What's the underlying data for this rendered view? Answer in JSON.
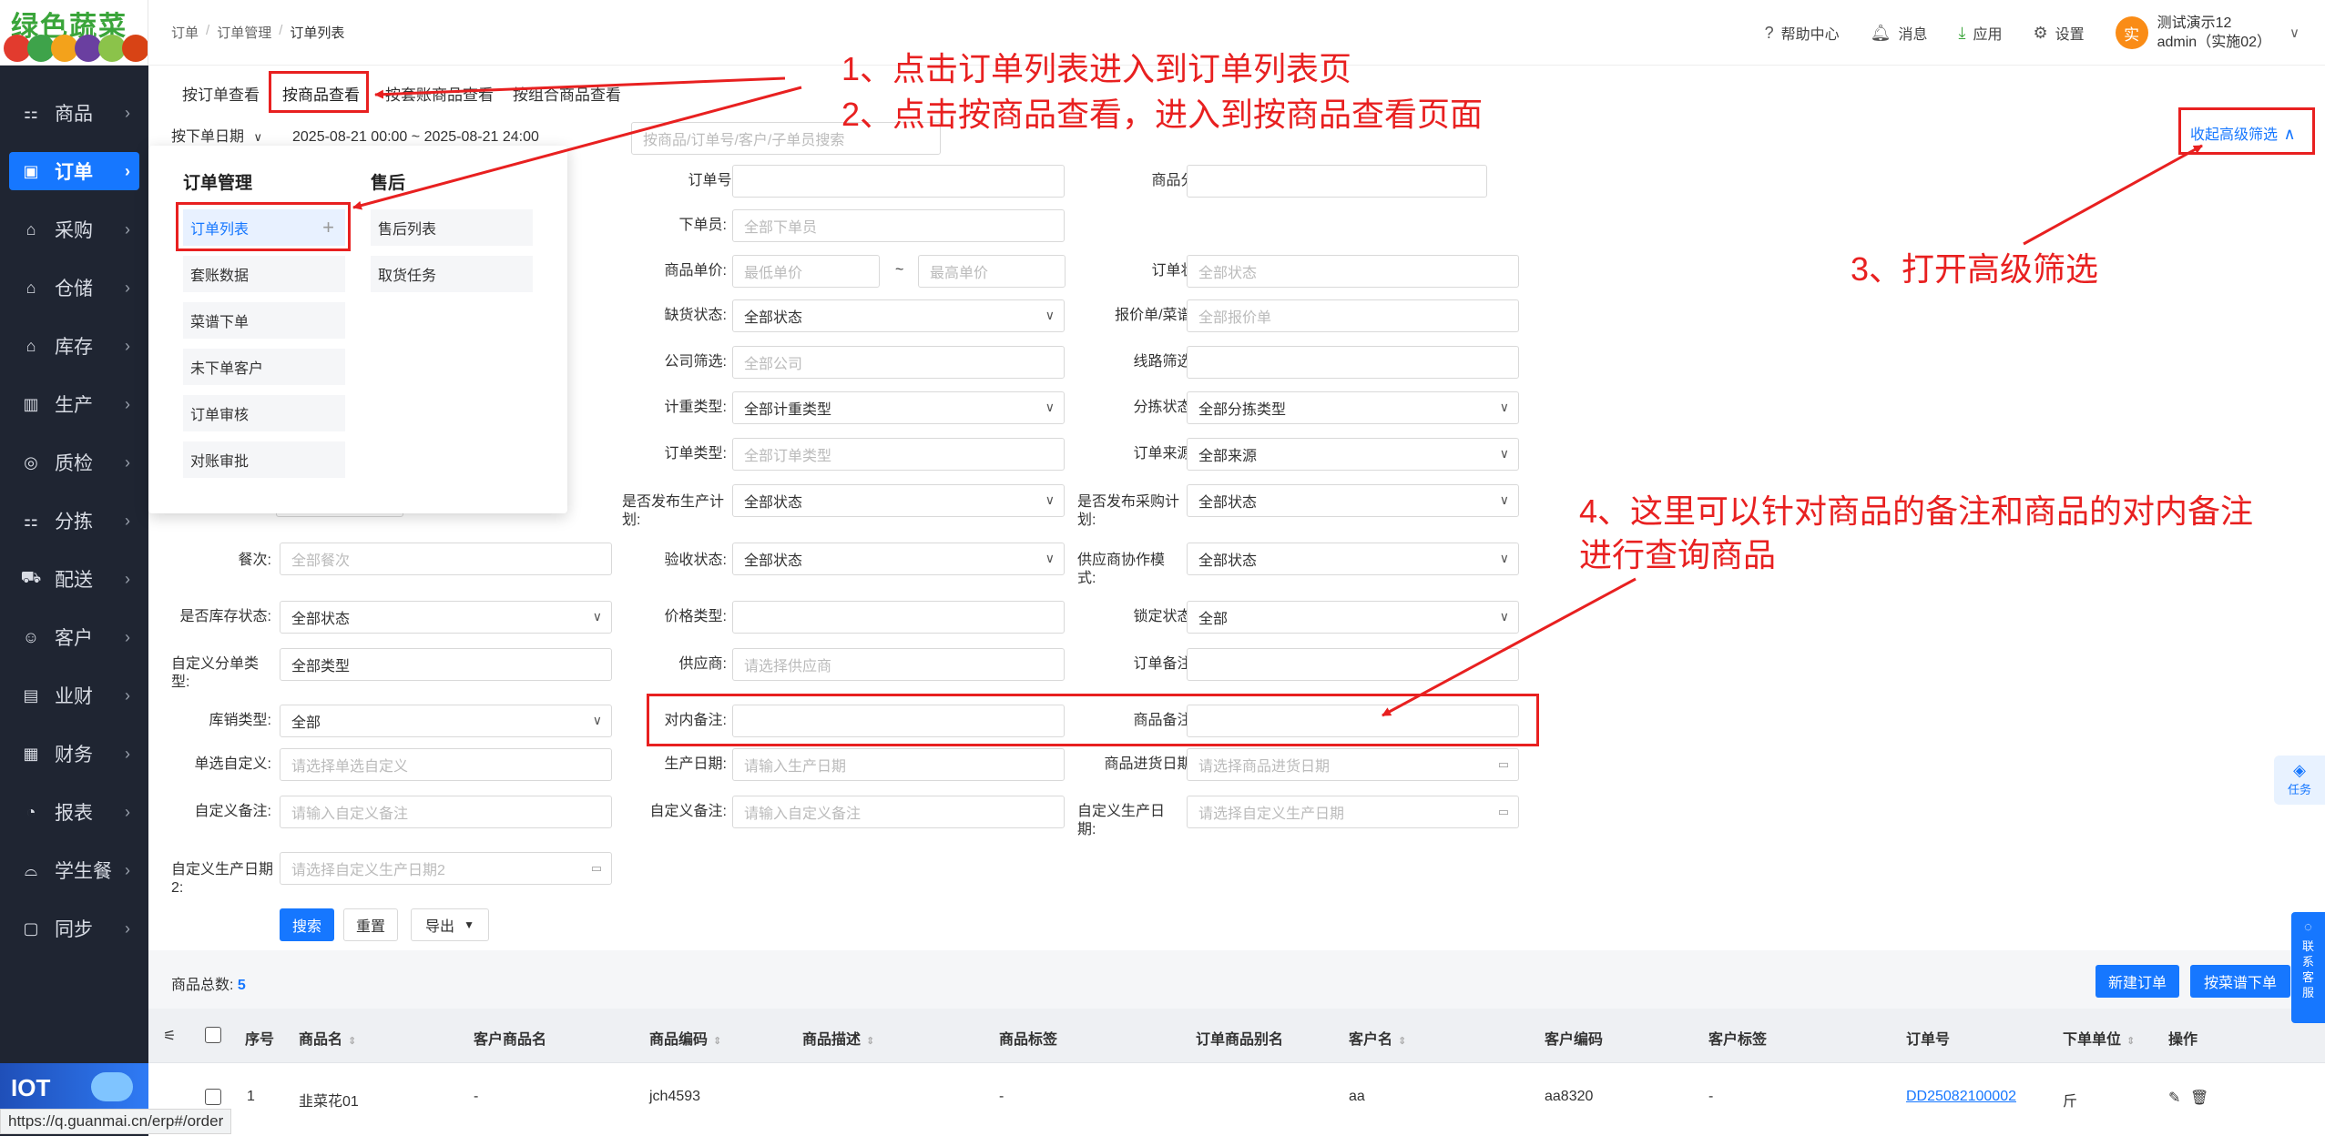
{
  "logo": {
    "text": "绿色蔬菜"
  },
  "sidebar": {
    "items": [
      {
        "label": "商品",
        "icon": "⚏"
      },
      {
        "label": "订单",
        "icon": "▣"
      },
      {
        "label": "采购",
        "icon": "⌂"
      },
      {
        "label": "仓储",
        "icon": "⌂"
      },
      {
        "label": "库存",
        "icon": "⌂"
      },
      {
        "label": "生产",
        "icon": "▥"
      },
      {
        "label": "质检",
        "icon": "◎"
      },
      {
        "label": "分拣",
        "icon": "⚏"
      },
      {
        "label": "配送",
        "icon": "⛟"
      },
      {
        "label": "客户",
        "icon": "☺"
      },
      {
        "label": "业财",
        "icon": "▤"
      },
      {
        "label": "财务",
        "icon": "▦"
      },
      {
        "label": "报表",
        "icon": "◔"
      },
      {
        "label": "学生餐",
        "icon": "⌓"
      },
      {
        "label": "同步",
        "icon": "▢"
      }
    ],
    "chevron": "›",
    "iot_label": "IOT"
  },
  "breadcrumb": {
    "items": [
      "订单",
      "订单管理",
      "订单列表"
    ],
    "sep": "/"
  },
  "header": {
    "help": "帮助中心",
    "messages": "消息",
    "apps": "应用",
    "settings": "设置",
    "avatar_char": "实",
    "user_line1": "测试演示12",
    "user_line2": "admin（实施02）"
  },
  "tabs": [
    "按订单查看",
    "按商品查看",
    "按套账商品查看",
    "按组合商品查看"
  ],
  "filters": {
    "date_type": "按下单日期",
    "date_range": "2025-08-21 00:00 ~ 2025-08-21 24:00",
    "search_placeholder": "按商品/订单号/客户/子单员搜索",
    "collapse_label": "收起高级筛选",
    "order_no_label": "订单号:",
    "category_label": "商品分类:",
    "placer_label": "下单员:",
    "placer_placeholder": "全部下单员",
    "unit_price_label": "商品单价:",
    "min_price": "最低单价",
    "max_price": "最高单价",
    "tilde": "~",
    "order_status_label": "订单状态:",
    "order_status_placeholder": "全部状态",
    "stockout_label": "缺货状态:",
    "stockout_value": "全部状态",
    "quote_label": "报价单/菜谱:",
    "quote_placeholder": "全部报价单",
    "company_label": "公司筛选:",
    "company_placeholder": "全部公司",
    "route_label": "线路筛选:",
    "measure_label": "计重类型:",
    "measure_value": "全部计重类型",
    "sort_status_label": "分拣状态:",
    "sort_status_value": "全部分拣类型",
    "order_type_label": "订单类型:",
    "order_type_placeholder": "全部订单类型",
    "order_source_label": "订单来源:",
    "order_source_value": "全部来源",
    "prod_plan_label": "是否发布生产计划:",
    "prod_plan_value": "全部状态",
    "purch_plan_label": "是否发布采购计划:",
    "purch_plan_value": "全部状态",
    "meal_label": "餐次:",
    "meal_placeholder": "全部餐次",
    "accept_label": "验收状态:",
    "accept_value": "全部状态",
    "supplier_mode_label": "供应商协作模式:",
    "supplier_mode_value": "全部状态",
    "stock_status_label": "是否库存状态:",
    "stock_status_value": "全部状态",
    "price_type_label": "价格类型:",
    "lock_label": "锁定状态:",
    "lock_value": "全部",
    "custom_split_label": "自定义分单类型:",
    "custom_split_value": "全部类型",
    "supplier_label": "供应商:",
    "supplier_placeholder": "请选择供应商",
    "order_note_label": "订单备注:",
    "sales_type_label": "库销类型:",
    "sales_type_value": "全部",
    "internal_note_label": "对内备注:",
    "goods_note_label": "商品备注:",
    "single_custom_label": "单选自定义:",
    "single_custom_placeholder": "请选择单选自定义",
    "prod_date_label": "生产日期:",
    "prod_date_placeholder": "请输入生产日期",
    "purchase_date_label": "商品进货日期:",
    "purchase_date_placeholder": "请选择商品进货日期",
    "custom_note_label": "自定义备注:",
    "custom_note_placeholder": "请输入自定义备注",
    "custom_note2_label": "自定义备注:",
    "custom_note2_placeholder": "请输入自定义备注",
    "custom_prod_date_label": "自定义生产日期:",
    "custom_prod_date_placeholder": "请选择自定义生产日期",
    "custom_prod_date2_label": "自定义生产日期2:",
    "custom_prod_date2_placeholder": "请选择自定义生产日期2",
    "search_btn": "搜索",
    "reset_btn": "重置",
    "export_btn": "导出"
  },
  "dropdown": {
    "group1_title": "订单管理",
    "group1_items": [
      "订单列表",
      "套账数据",
      "菜谱下单",
      "未下单客户",
      "订单审核",
      "对账审批"
    ],
    "group2_title": "售后",
    "group2_items": [
      "售后列表",
      "取货任务"
    ],
    "plus": "+"
  },
  "list": {
    "count_label": "商品总数:",
    "count_value": "5",
    "new_order_btn": "新建订单",
    "recipe_order_btn": "按菜谱下单",
    "columns": [
      "序号",
      "商品名",
      "客户商品名",
      "商品编码",
      "商品描述",
      "商品标签",
      "订单商品别名",
      "客户名",
      "客户编码",
      "客户标签",
      "订单号",
      "下单单位",
      "操作"
    ],
    "rows": [
      {
        "seq": "1",
        "name": "韭菜花01",
        "customer_goods_name": "-",
        "code": "jch4593",
        "desc": "-",
        "customer": "aa",
        "customer_code": "aa8320",
        "customer_tag": "-",
        "order_no": "DD25082100002",
        "unit": "斤"
      }
    ]
  },
  "float": {
    "task": "任务",
    "service": "联系客服"
  },
  "status_url": "https://q.guanmai.cn/erp#/order",
  "annotations": {
    "step1": "1、点击订单列表进入到订单列表页",
    "step2": "2、点击按商品查看，进入到按商品查看页面",
    "step3": "3、打开高级筛选",
    "step4_line1": "4、这里可以针对商品的备注和商品的对内备注",
    "step4_line2": "进行查询商品",
    "color": "#e82020"
  },
  "colors": {
    "primary": "#1677ff",
    "sidebar": "#1f2532",
    "annotation": "#e82020"
  }
}
